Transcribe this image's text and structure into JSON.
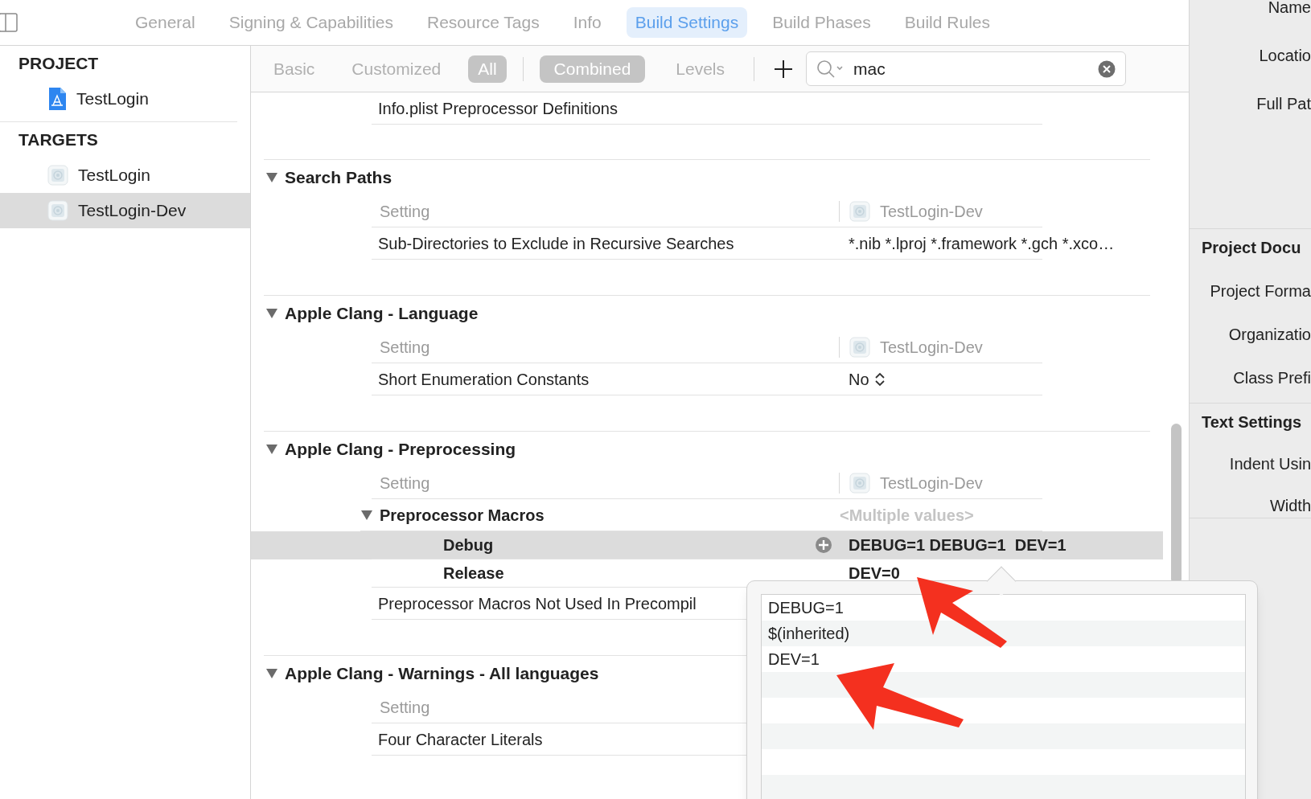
{
  "top_tabs": [
    {
      "label": "General",
      "selected": false
    },
    {
      "label": "Signing & Capabilities",
      "selected": false
    },
    {
      "label": "Resource Tags",
      "selected": false
    },
    {
      "label": "Info",
      "selected": false
    },
    {
      "label": "Build Settings",
      "selected": true
    },
    {
      "label": "Build Phases",
      "selected": false
    },
    {
      "label": "Build Rules",
      "selected": false
    }
  ],
  "sidebar": {
    "sections": [
      {
        "title": "PROJECT",
        "items": [
          {
            "label": "TestLogin",
            "kind": "project",
            "selected": false
          }
        ]
      },
      {
        "title": "TARGETS",
        "items": [
          {
            "label": "TestLogin",
            "kind": "target",
            "selected": false
          },
          {
            "label": "TestLogin-Dev",
            "kind": "target",
            "selected": true
          }
        ]
      }
    ]
  },
  "filter_bar": {
    "scopes": [
      {
        "label": "Basic",
        "selected": false
      },
      {
        "label": "Customized",
        "selected": false
      },
      {
        "label": "All",
        "selected": true
      }
    ],
    "views": [
      {
        "label": "Combined",
        "selected": true
      },
      {
        "label": "Levels",
        "selected": false
      }
    ],
    "search": {
      "value": "mac"
    }
  },
  "settings": {
    "leading_rows": [
      {
        "name": "Info.plist Preprocessor Definitions"
      }
    ],
    "sections": [
      {
        "title": "Search Paths",
        "expanded": true,
        "column_setting": "Setting",
        "column_target": "TestLogin-Dev",
        "rows": [
          {
            "kind": "plain",
            "name": "Sub-Directories to Exclude in Recursive Searches",
            "value": "*.nib *.lproj *.framework *.gch *.xco…"
          }
        ]
      },
      {
        "title": "Apple Clang - Language",
        "expanded": true,
        "column_setting": "Setting",
        "column_target": "TestLogin-Dev",
        "rows": [
          {
            "kind": "popup",
            "name": "Short Enumeration Constants",
            "value": "No"
          }
        ]
      },
      {
        "title": "Apple Clang - Preprocessing",
        "expanded": true,
        "column_setting": "Setting",
        "column_target": "TestLogin-Dev",
        "rows": [
          {
            "kind": "group",
            "name": "Preprocessor Macros",
            "expanded": true,
            "value": "<Multiple values>",
            "children": [
              {
                "name": "Debug",
                "selected": true,
                "value": "DEBUG=1 DEBUG=1  DEV=1"
              },
              {
                "name": "Release",
                "selected": false,
                "value": "DEV=0"
              }
            ]
          },
          {
            "kind": "plain",
            "name": "Preprocessor Macros Not Used In Precompil"
          }
        ]
      },
      {
        "title": "Apple Clang - Warnings - All languages",
        "expanded": true,
        "column_setting": "Setting",
        "rows": [
          {
            "kind": "plain",
            "name": "Four Character Literals"
          }
        ]
      }
    ]
  },
  "popup": {
    "items": [
      "DEBUG=1",
      "$(inherited)",
      "DEV=1"
    ]
  },
  "inspector": {
    "sections": [
      {
        "items": [
          {
            "kind": "label",
            "text": "Name"
          },
          {
            "kind": "label",
            "text": "Locatio"
          },
          {
            "kind": "label",
            "text": "Full Pat"
          }
        ]
      },
      {
        "items": [
          {
            "kind": "heading",
            "text": "Project Docu"
          },
          {
            "kind": "label",
            "text": "Project Forma"
          },
          {
            "kind": "label",
            "text": "Organizatio"
          },
          {
            "kind": "label",
            "text": "Class Prefi"
          }
        ]
      },
      {
        "items": [
          {
            "kind": "heading",
            "text": "Text Settings"
          },
          {
            "kind": "label",
            "text": "Indent Usin"
          },
          {
            "kind": "label",
            "text": "Width"
          }
        ]
      }
    ]
  }
}
